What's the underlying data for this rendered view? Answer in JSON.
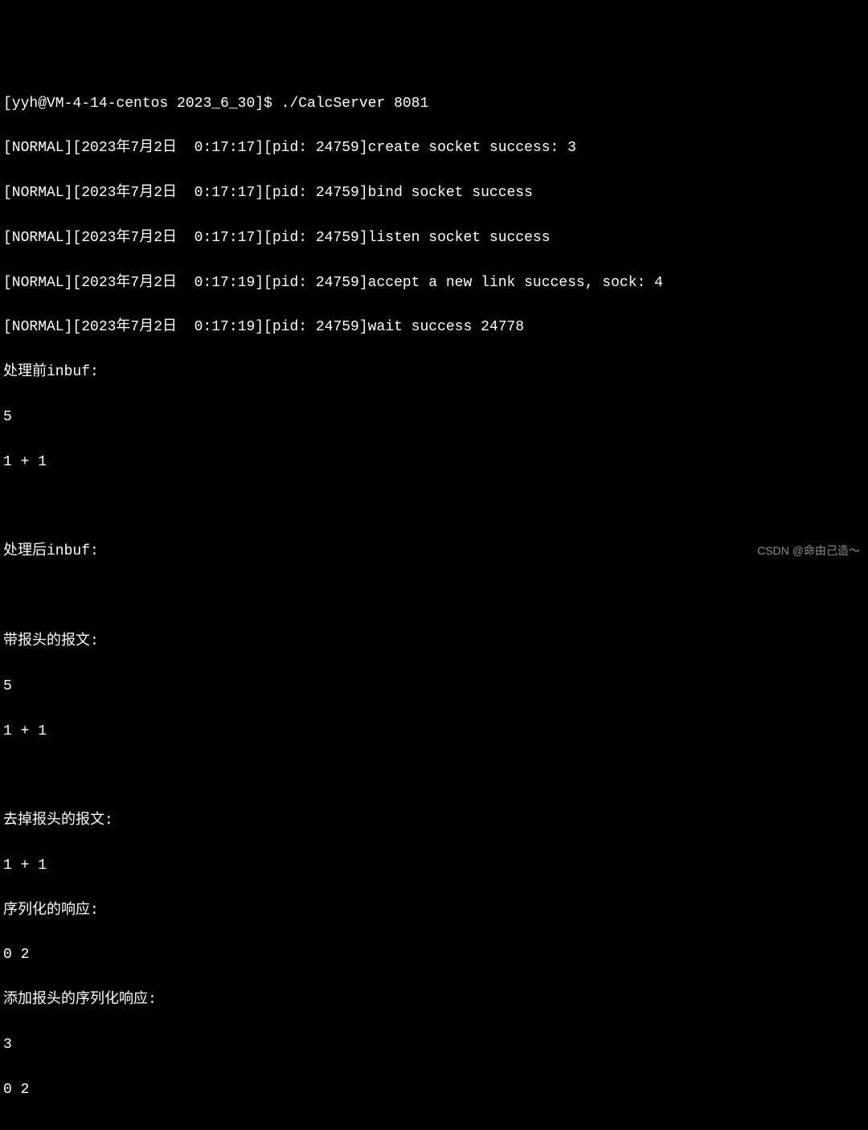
{
  "prompt_line": "[yyh@VM-4-14-centos 2023_6_30]$ ./CalcServer 8081",
  "lines": {
    "l0": "[NORMAL][2023年7月2日  0:17:17][pid: 24759]create socket success: 3",
    "l1": "[NORMAL][2023年7月2日  0:17:17][pid: 24759]bind socket success",
    "l2": "[NORMAL][2023年7月2日  0:17:17][pid: 24759]listen socket success",
    "l3": "[NORMAL][2023年7月2日  0:17:19][pid: 24759]accept a new link success, sock: 4",
    "l4": "[NORMAL][2023年7月2日  0:17:19][pid: 24759]wait success 24778",
    "l5": "处理前inbuf:",
    "l6": "5",
    "l7": "1 + 1",
    "l8": " ",
    "l9": "处理后inbuf:",
    "l10": " ",
    "l11": "带报头的报文:",
    "l12": "5",
    "l13": "1 + 1",
    "l14": " ",
    "l15": "去掉报头的报文:",
    "l16": "1 + 1",
    "l17": "序列化的响应:",
    "l18": "0 2",
    "l19": "添加报头的序列化响应:",
    "l20": "3",
    "l21": "0 2"
  },
  "watermark": "CSDN @命由己造～"
}
